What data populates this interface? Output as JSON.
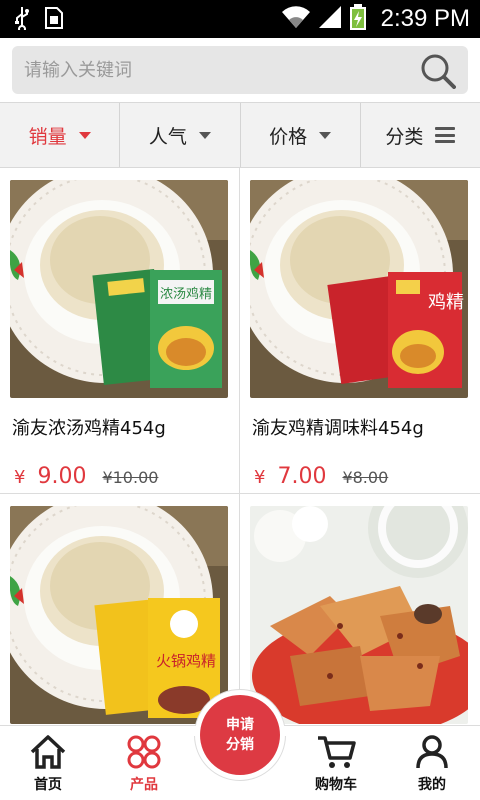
{
  "status_bar": {
    "time": "2:39 PM",
    "left_icons": [
      "usb-icon",
      "sim-icon"
    ],
    "right_icons": [
      "wifi-icon",
      "signal-icon",
      "battery-charging-icon"
    ]
  },
  "search": {
    "placeholder": "请输入关键词",
    "value": ""
  },
  "filters": [
    {
      "label": "销量",
      "icon": "caret-down-icon",
      "active": true
    },
    {
      "label": "人气",
      "icon": "caret-down-icon",
      "active": false
    },
    {
      "label": "价格",
      "icon": "caret-down-icon",
      "active": false
    },
    {
      "label": "分类",
      "icon": "menu-icon",
      "active": false
    }
  ],
  "products": [
    {
      "name": "渝友浓汤鸡精454g",
      "currency": "¥",
      "price": "9.00",
      "original_price": "¥10.00",
      "package_text": "浓汤鸡精"
    },
    {
      "name": "渝友鸡精调味料454g",
      "currency": "¥",
      "price": "7.00",
      "original_price": "¥8.00",
      "package_text": "鸡精"
    },
    {
      "name": "",
      "currency": "",
      "price": "",
      "original_price": "",
      "package_text": "火锅鸡精"
    },
    {
      "name": "",
      "currency": "",
      "price": "",
      "original_price": "",
      "package_text": ""
    }
  ],
  "bottom_nav": {
    "items": [
      {
        "label": "首页",
        "icon": "home-icon",
        "active": false
      },
      {
        "label": "产品",
        "icon": "products-icon",
        "active": true
      },
      {
        "label": "购物车",
        "icon": "cart-icon",
        "active": false
      },
      {
        "label": "我的",
        "icon": "user-icon",
        "active": false
      }
    ],
    "center_button": {
      "line1": "申请",
      "line2": "分销"
    }
  },
  "colors": {
    "accent": "#e0383e",
    "status_bar": "#000000",
    "search_bg": "#e6e6e6",
    "filter_bg": "#f2f2f2"
  }
}
